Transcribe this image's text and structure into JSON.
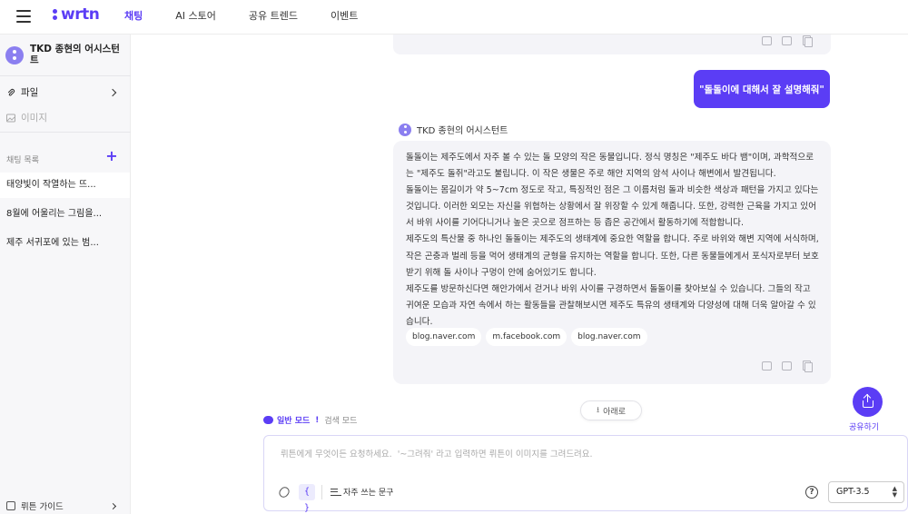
{
  "header": {
    "logo_text": "wrtn",
    "nav": [
      "채팅",
      "AI 스토어",
      "공유 트렌드",
      "이벤트"
    ],
    "active_nav": 0
  },
  "sidebar": {
    "assistant_name": "TKD 종현의 어시스턴트",
    "file_label": "파일",
    "image_label": "이미지",
    "chat_list_label": "채팅 목록",
    "chats": [
      "태양빛이 작열하는 뜨...",
      "8월에 어울리는 그림을...",
      "제주 서귀포에 있는 범..."
    ],
    "guide_label": "뤼튼 가이드"
  },
  "conversation": {
    "user_message": "\"돌돌이에 대해서 잘 설명해줘\"",
    "bot_name": "TKD 종현의 어시스턴트",
    "bot_paragraphs": [
      "돌돌이는 제주도에서 자주 볼 수 있는 돌 모양의 작은 동물입니다. 정식 명칭은 \"제주도 바다 뱀\"이며, 과학적으로는 \"제주도 돌쥐\"라고도 불립니다. 이 작은 생물은 주로 해안 지역의 암석 사이나 해변에서 발견됩니다.",
      "돌돌이는 몸길이가 약 5~7cm 정도로 작고, 특징적인 점은 그 이름처럼 돌과 비슷한 색상과 패턴을 가지고 있다는 것입니다. 이러한 외모는 자신을 위협하는 상황에서 잘 위장할 수 있게 해줍니다. 또한, 강력한 근육을 가지고 있어서 바위 사이를 기어다니거나 높은 곳으로 점프하는 등 좁은 공간에서 활동하기에 적합합니다.",
      "제주도의 특산물 중 하나인 돌돌이는 제주도의 생태계에 중요한 역할을 합니다. 주로 바위와 해변 지역에 서식하며, 작은 곤충과 벌레 등을 먹어 생태계의 균형을 유지하는 역할을 합니다. 또한, 다른 동물들에게서 포식자로부터 보호받기 위해 돌 사이나 구멍이 안에 숨어있기도 합니다.",
      "제주도를 방문하신다면 해안가에서 걷거나 바위 사이를 구경하면서 돌돌이를 찾아보실 수 있습니다. 그들의 작고 귀여운 모습과 자연 속에서 하는 활동들을 관찰해보시면 제주도 특유의 생태계와 다양성에 대해 더욱 알아갈 수 있습니다."
    ],
    "sources": [
      "blog.naver.com",
      "m.facebook.com",
      "blog.naver.com"
    ]
  },
  "controls": {
    "scroll_down_label": "아래로",
    "share_label": "공유하기",
    "mode_general": "일반 모드",
    "mode_bang": "!",
    "mode_search": "검색 모드",
    "input_placeholder": "뤼튼에게 무엇이든 요청하세요.  '~그려줘' 라고 입력하면 뤼튼이 이미지를 그려드려요.",
    "input_value": "",
    "brace_label": "{ }",
    "phrases_label": "자주 쓰는 문구",
    "help_label": "?",
    "model": "GPT-3.5"
  },
  "colors": {
    "accent": "#5b3df5",
    "card_bg": "#f4f4f8",
    "sidebar_bg": "#f7f7f9"
  }
}
